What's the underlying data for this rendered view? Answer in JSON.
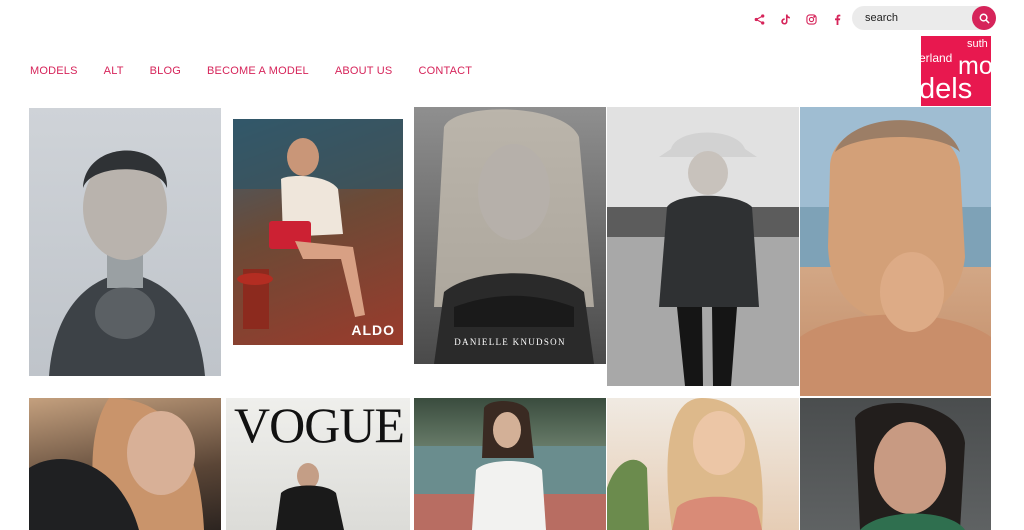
{
  "social": {
    "icons": [
      "share-icon",
      "tiktok-icon",
      "instagram-icon",
      "facebook-icon"
    ]
  },
  "search": {
    "value": "",
    "placeholder": "search"
  },
  "nav": {
    "items": [
      "MODELS",
      "ALT",
      "BLOG",
      "BECOME A MODEL",
      "ABOUT US",
      "CONTACT"
    ]
  },
  "logo": {
    "line1": "suth",
    "line2": "erland",
    "line3": "mo",
    "line4": "dels"
  },
  "grid": {
    "tiles": [
      {
        "caption": ""
      },
      {
        "caption": "ALDO"
      },
      {
        "caption": "DANIELLE KNUDSON"
      },
      {
        "caption": ""
      },
      {
        "caption": ""
      },
      {
        "caption": ""
      },
      {
        "caption": "VOGUE"
      },
      {
        "caption": ""
      },
      {
        "caption": ""
      },
      {
        "caption": ""
      }
    ]
  },
  "colors": {
    "accent": "#d6245a",
    "logo_bg": "#e8184f"
  }
}
